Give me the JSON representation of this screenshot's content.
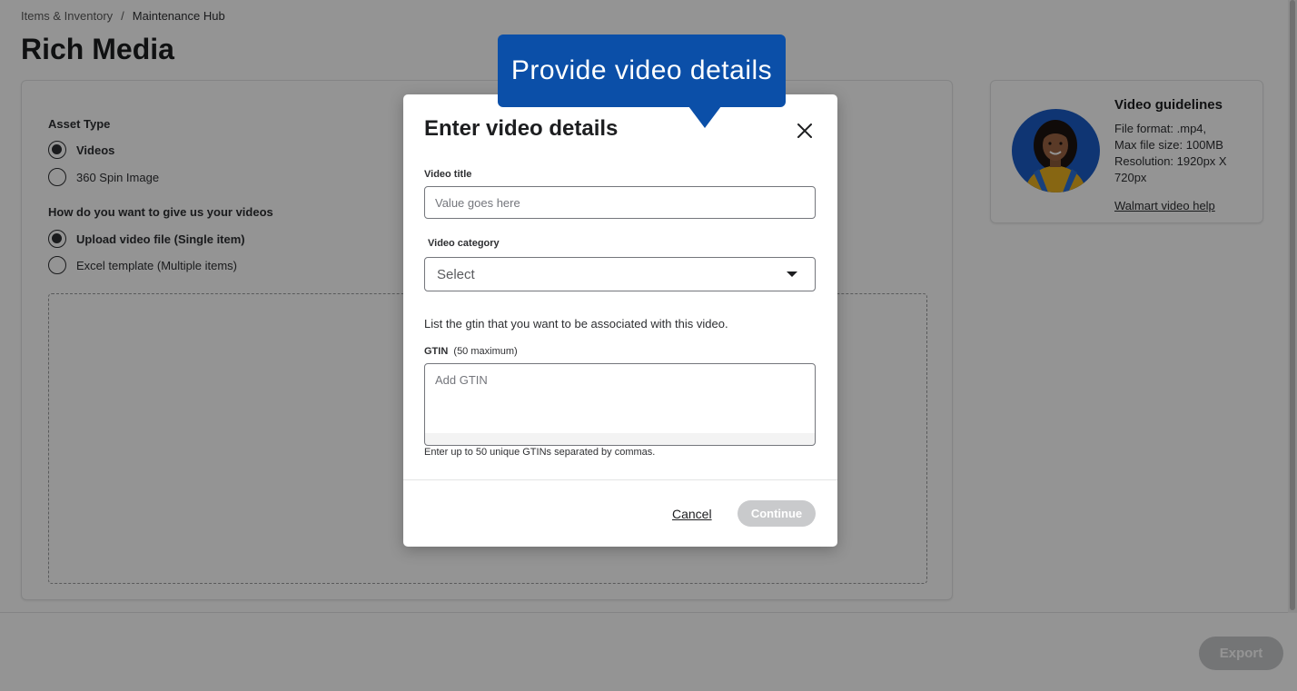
{
  "breadcrumb": {
    "items": [
      "Items & Inventory",
      "Maintenance Hub"
    ],
    "separator": "/"
  },
  "page": {
    "title": "Rich Media"
  },
  "asset_type": {
    "label": "Asset Type",
    "options": [
      {
        "label": "Videos",
        "checked": true
      },
      {
        "label": "360 Spin Image",
        "checked": false
      }
    ]
  },
  "upload_method": {
    "label": "How do you want to give us your videos",
    "options": [
      {
        "label": "Upload video file (Single item)",
        "checked": true
      },
      {
        "label": "Excel template (Multiple items)",
        "checked": false
      }
    ]
  },
  "guidelines": {
    "title": "Video guidelines",
    "lines": [
      "File format: .mp4,",
      "Max file size: 100MB",
      "Resolution: 1920px X 720px"
    ],
    "link": "Walmart video help"
  },
  "footer": {
    "export_label": "Export"
  },
  "tooltip": {
    "text": "Provide video details"
  },
  "modal": {
    "title": "Enter video details",
    "video_title": {
      "label": "Video title",
      "placeholder": "Value goes here"
    },
    "video_category": {
      "label": "Video category",
      "selected": "Select"
    },
    "gtin_intro": "List the gtin that you want to be associated with this video.",
    "gtin": {
      "label": "GTIN",
      "label_note": "(50 maximum)",
      "placeholder": "Add GTIN",
      "help": "Enter up to 50 unique GTINs separated by commas."
    },
    "cancel_label": "Cancel",
    "continue_label": "Continue"
  },
  "colors": {
    "tooltip_bg": "#0b4fa8",
    "avatar_bg": "#1a5cc7",
    "disabled_button": "#c9cacc"
  }
}
